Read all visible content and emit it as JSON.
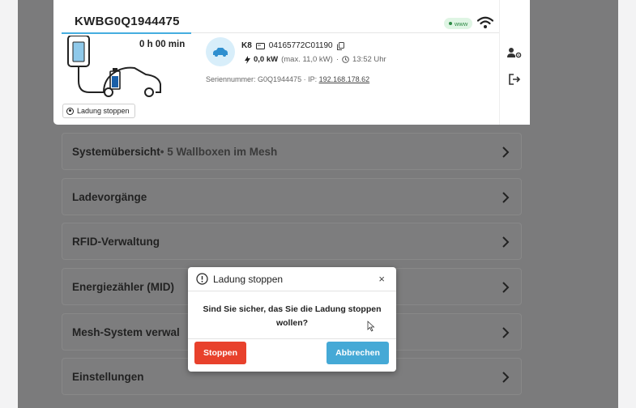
{
  "wallbox": {
    "title": "KWBG0Q1944475",
    "duration": "0 h 00 min",
    "stop_chip_label": "Ladung stoppen"
  },
  "vehicle": {
    "name": "K8",
    "card_id": "04165772C01190",
    "power": "0,0 kW",
    "max": "(max. 11,0 kW)",
    "separator": "·",
    "time": "13:52 Uhr",
    "serial_prefix": "Seriennummer: G0Q1944475 · IP:",
    "ip": "192.168.178.62"
  },
  "status": {
    "www_label": "www"
  },
  "menu": {
    "items": [
      {
        "label": "Systemübersicht",
        "suffix": " • 5 Wallboxen im Mesh"
      },
      {
        "label": "Ladevorgänge",
        "suffix": ""
      },
      {
        "label": "RFID-Verwaltung",
        "suffix": ""
      },
      {
        "label": "Energiezähler (MID)",
        "suffix": ""
      },
      {
        "label": "Mesh-System verwal",
        "suffix": ""
      },
      {
        "label": "Einstellungen",
        "suffix": ""
      }
    ]
  },
  "modal": {
    "title": "Ladung stoppen",
    "close": "×",
    "message": "Sind Sie sicher, das Sie die Ladung stoppen wollen?",
    "stop_label": "Stoppen",
    "cancel_label": "Abbrechen"
  },
  "colors": {
    "accent_blue": "#45a9d6",
    "danger_red": "#e8412c",
    "online_green": "#2d8a45",
    "overlay_gray": "#7b7b7c"
  },
  "icons": [
    "wifi-icon",
    "user-settings-icon",
    "logout-icon",
    "car-icon",
    "card-icon",
    "copy-icon",
    "bolt-icon",
    "clock-icon",
    "chevron-right-icon",
    "info-icon",
    "close-icon",
    "cursor-icon"
  ]
}
